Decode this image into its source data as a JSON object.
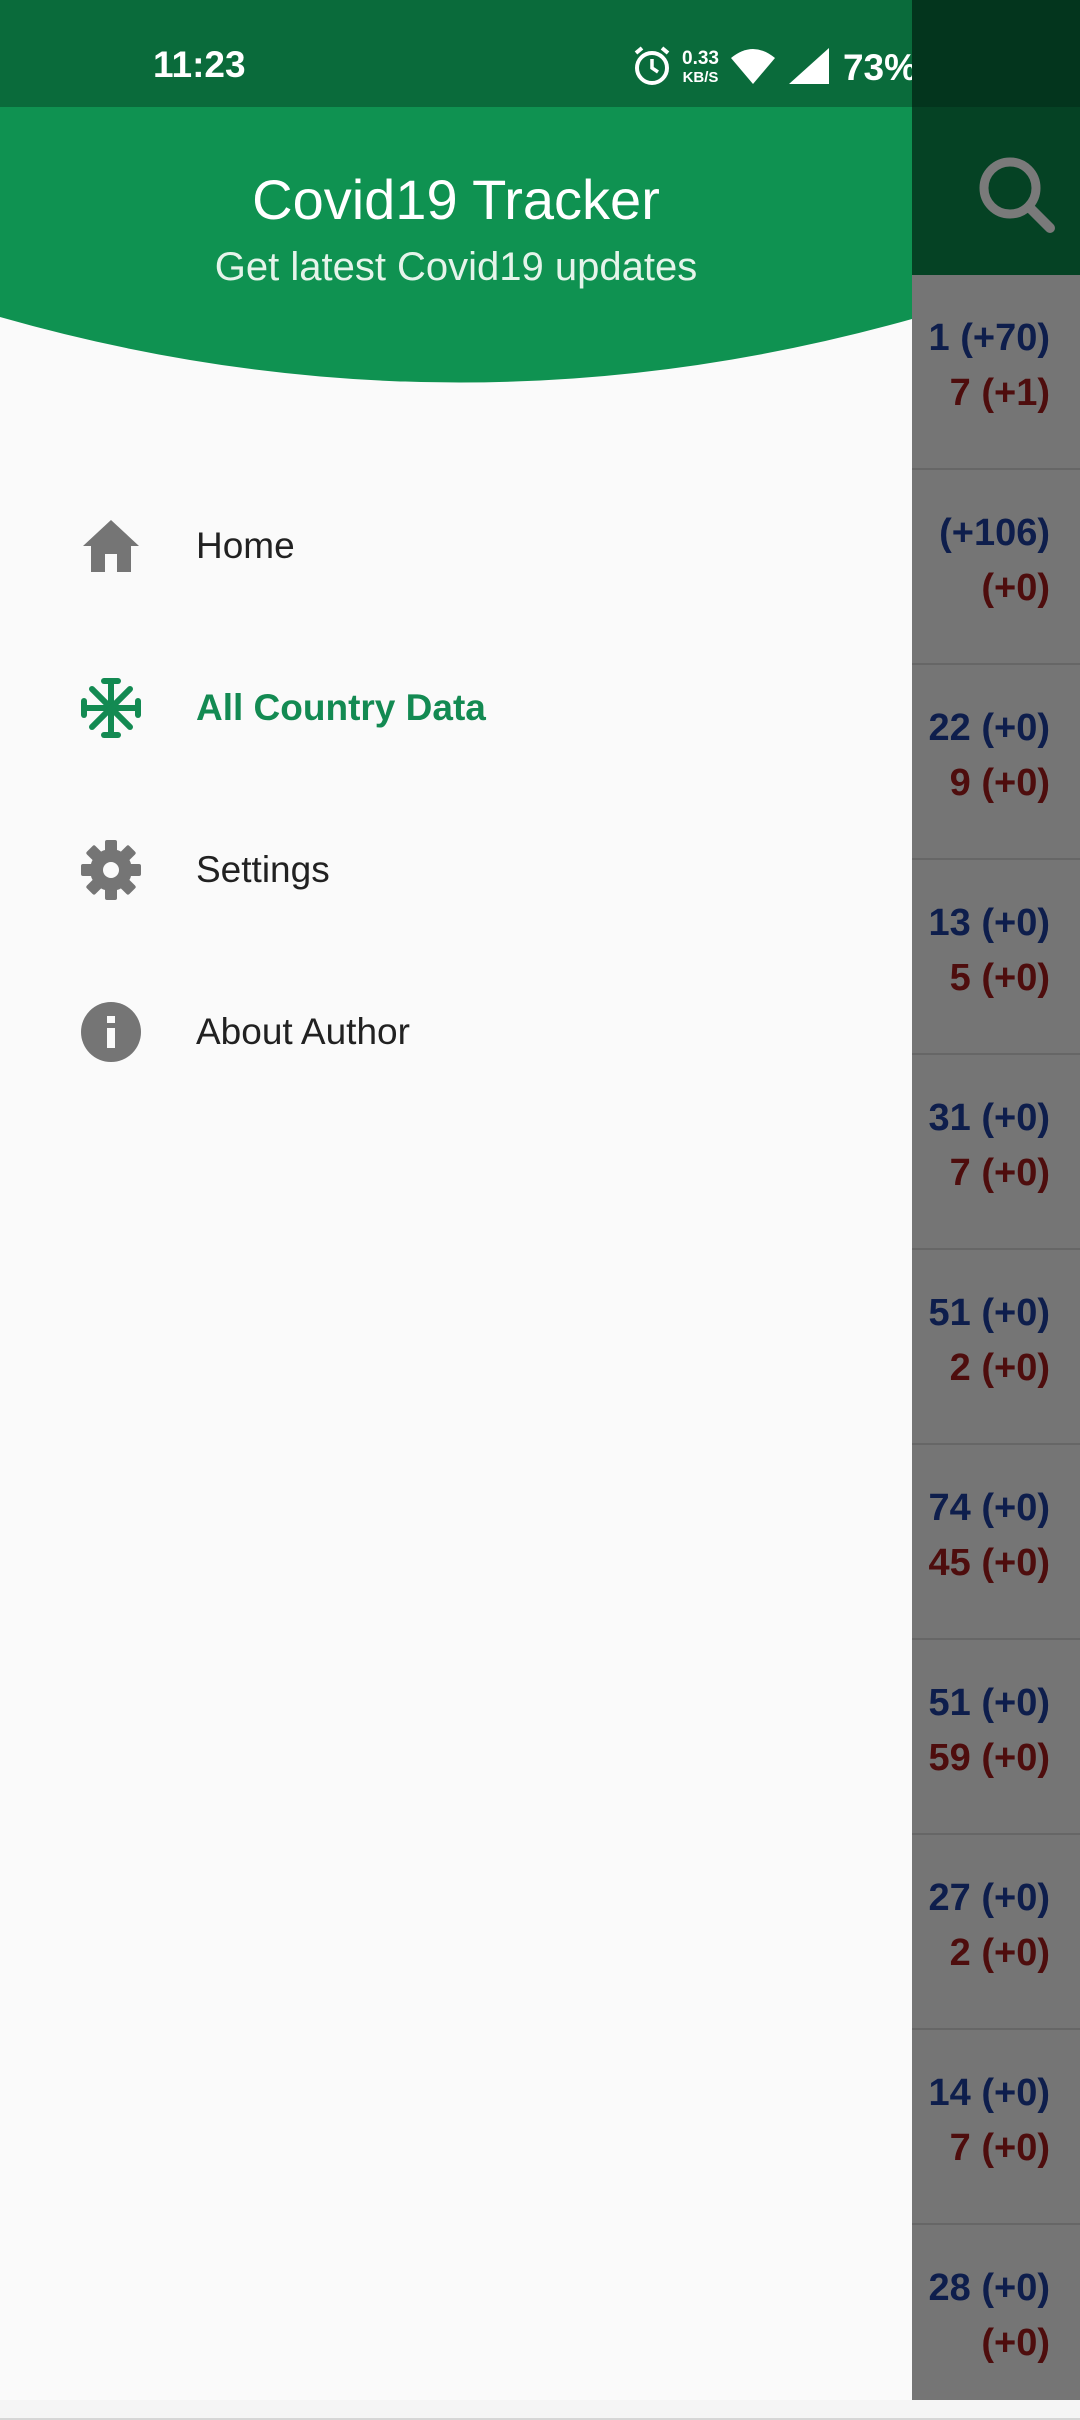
{
  "status_bar": {
    "time": "11:23",
    "net_speed_value": "0.33",
    "net_speed_unit": "KB/S",
    "battery": "73%"
  },
  "drawer": {
    "title": "Covid19 Tracker",
    "subtitle": "Get latest Covid19 updates",
    "items": [
      {
        "label": "Home",
        "icon": "home-icon",
        "active": false
      },
      {
        "label": "All Country Data",
        "icon": "virus-icon",
        "active": true
      },
      {
        "label": "Settings",
        "icon": "gear-icon",
        "active": false
      },
      {
        "label": "About Author",
        "icon": "info-icon",
        "active": false
      }
    ]
  },
  "background_list": {
    "rows": [
      {
        "line1": "1 (+70)",
        "line2": "7 (+1)"
      },
      {
        "line1": "(+106)",
        "line2": "(+0)"
      },
      {
        "line1": "22 (+0)",
        "line2": "9 (+0)"
      },
      {
        "line1": "13 (+0)",
        "line2": "5 (+0)"
      },
      {
        "line1": "31 (+0)",
        "line2": "7 (+0)"
      },
      {
        "line1": "51 (+0)",
        "line2": "2 (+0)"
      },
      {
        "line1": "74 (+0)",
        "line2": "45 (+0)"
      },
      {
        "line1": "51 (+0)",
        "line2": "59 (+0)"
      },
      {
        "line1": "27 (+0)",
        "line2": "2 (+0)"
      },
      {
        "line1": "14 (+0)",
        "line2": "7 (+0)"
      },
      {
        "line1": "28 (+0)",
        "line2": "(+0)"
      }
    ]
  },
  "colors": {
    "primary": "#0b8a4c",
    "status_bar": "#0a6b3b",
    "active_item": "#138a52",
    "confirmed_text": "#1f3f9f",
    "deaths_text": "#a31d1d"
  }
}
